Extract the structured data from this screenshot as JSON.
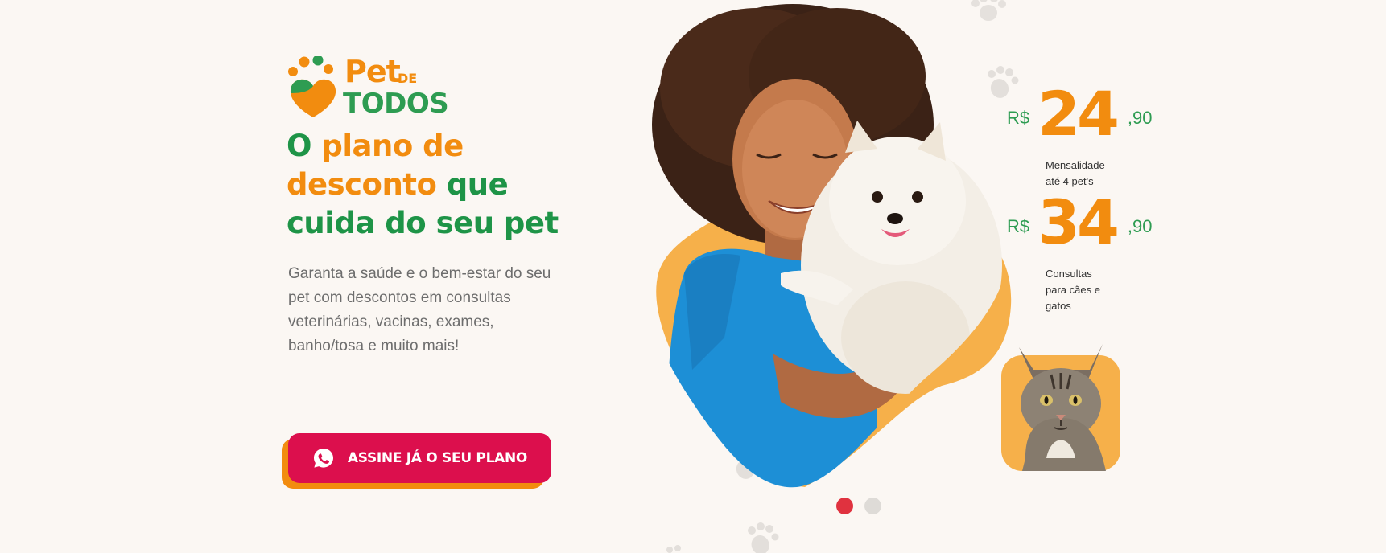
{
  "brand": {
    "word_pet": "Pet",
    "word_de": "DE",
    "word_todos": "TODOS",
    "colors": {
      "orange": "#f28c0f",
      "green": "#2e9c52",
      "cta_red": "#dc0f4d"
    }
  },
  "hero": {
    "headline": {
      "part1": "O ",
      "part2": "plano de desconto ",
      "part3": " que cuida do seu pet"
    },
    "subtext": "Garanta a saúde e o bem-estar do seu pet com descontos em consultas veterinárias, vacinas, exames, banho/tosa e muito mais!",
    "cta_label": "ASSINE JÁ O SEU PLANO",
    "cta_icon": "whatsapp-icon"
  },
  "prices": [
    {
      "currency": "R$",
      "integer": "24",
      "cents": ",90",
      "note_line1": "Mensalidade",
      "note_line2": "até 4 pet's",
      "note_line3": ""
    },
    {
      "currency": "R$",
      "integer": "34",
      "cents": ",90",
      "note_line1": "Consultas",
      "note_line2": "para cães e",
      "note_line3": "gatos"
    }
  ],
  "carousel": {
    "active_index": 0,
    "count": 2
  }
}
